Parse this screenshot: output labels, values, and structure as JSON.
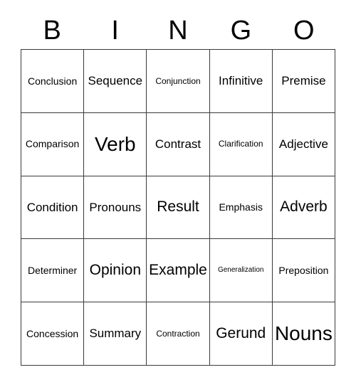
{
  "card": {
    "title": "BINGO",
    "header_letters": [
      "B",
      "I",
      "N",
      "G",
      "O"
    ],
    "colors": {
      "background": "#ffffff",
      "text": "#000000",
      "border": "#3a3a3a"
    },
    "rows": [
      [
        {
          "label": "Conclusion",
          "size": "sm"
        },
        {
          "label": "Sequence",
          "size": "md"
        },
        {
          "label": "Conjunction",
          "size": "xs"
        },
        {
          "label": "Infinitive",
          "size": "md"
        },
        {
          "label": "Premise",
          "size": "md"
        }
      ],
      [
        {
          "label": "Comparison",
          "size": "sm"
        },
        {
          "label": "Verb",
          "size": "xl"
        },
        {
          "label": "Contrast",
          "size": "md"
        },
        {
          "label": "Clarification",
          "size": "xs"
        },
        {
          "label": "Adjective",
          "size": "md"
        }
      ],
      [
        {
          "label": "Condition",
          "size": "md"
        },
        {
          "label": "Pronouns",
          "size": "md"
        },
        {
          "label": "Result",
          "size": "lg"
        },
        {
          "label": "Emphasis",
          "size": "sm"
        },
        {
          "label": "Adverb",
          "size": "lg"
        }
      ],
      [
        {
          "label": "Determiner",
          "size": "sm"
        },
        {
          "label": "Opinion",
          "size": "lg"
        },
        {
          "label": "Example",
          "size": "lg"
        },
        {
          "label": "Generalization",
          "size": "xxs"
        },
        {
          "label": "Preposition",
          "size": "sm"
        }
      ],
      [
        {
          "label": "Concession",
          "size": "sm"
        },
        {
          "label": "Summary",
          "size": "md"
        },
        {
          "label": "Contraction",
          "size": "xs"
        },
        {
          "label": "Gerund",
          "size": "lg"
        },
        {
          "label": "Nouns",
          "size": "xl"
        }
      ]
    ]
  }
}
